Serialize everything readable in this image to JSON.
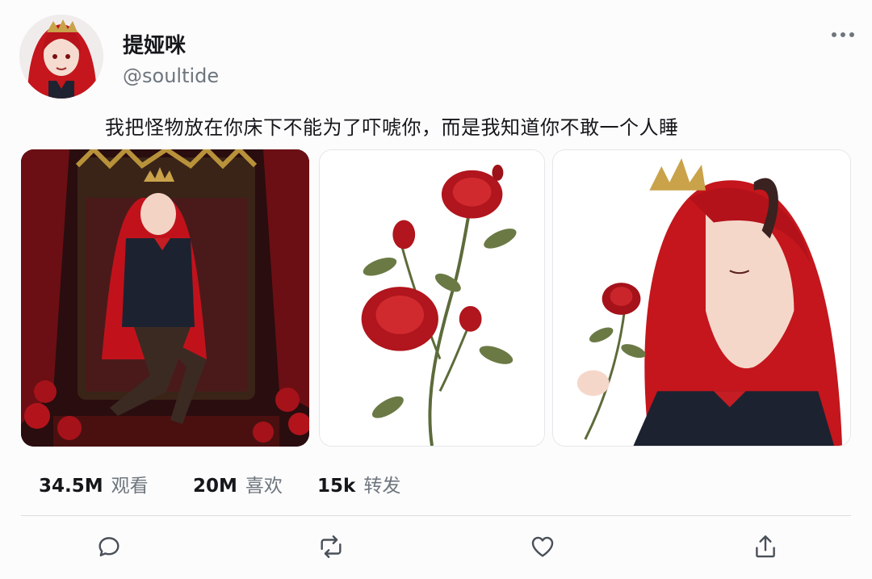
{
  "post": {
    "author": {
      "display_name": "提娅咪",
      "handle": "@soultide"
    },
    "text": "我把怪物放在你床下不能为了吓唬你，而是我知道你不敢一个人睡"
  },
  "stats": [
    {
      "value": "34.5M",
      "label": "观看"
    },
    {
      "value": "20M",
      "label": "喜欢"
    },
    {
      "value": "15k",
      "label": "转发"
    }
  ],
  "actions": [
    {
      "icon": "reply-icon"
    },
    {
      "icon": "retweet-icon"
    },
    {
      "icon": "like-icon"
    },
    {
      "icon": "share-icon"
    }
  ],
  "media": [
    {
      "icon": "throne-portrait-image"
    },
    {
      "icon": "rose-illustration-image"
    },
    {
      "icon": "rose-profile-image"
    }
  ],
  "colors": {
    "accent_red": "#c41e24",
    "text_muted": "#6e767d",
    "divider": "#dcdde0"
  }
}
